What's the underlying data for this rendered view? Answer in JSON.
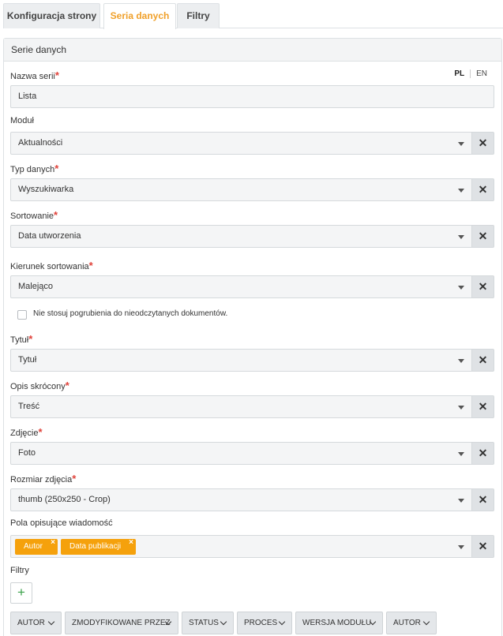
{
  "tabs": [
    {
      "label": "Konfiguracja strony"
    },
    {
      "label": "Seria danych"
    },
    {
      "label": "Filtry"
    }
  ],
  "active_tab": "Seria danych",
  "panel": {
    "title": "Serie danych"
  },
  "lang": {
    "pl": "PL",
    "en": "EN"
  },
  "form": {
    "required_mark": "*",
    "clear_glyph": "✕",
    "nazwa_serii": {
      "label": "Nazwa serii",
      "value": "Lista"
    },
    "modul": {
      "label": "Moduł",
      "value": "Aktualności"
    },
    "typ_danych": {
      "label": "Typ danych",
      "value": "Wyszukiwarka"
    },
    "sortowanie": {
      "label": "Sortowanie",
      "value": "Data utworzenia"
    },
    "kierunek": {
      "label": "Kierunek sortowania",
      "value": "Malejąco"
    },
    "checkbox": {
      "label": "Nie stosuj pogrubienia do nieodczytanych dokumentów.",
      "checked": false
    },
    "tytul": {
      "label": "Tytuł",
      "value": "Tytuł"
    },
    "opis": {
      "label": "Opis skrócony",
      "value": "Treść"
    },
    "zdjecie": {
      "label": "Zdjęcie",
      "value": "Foto"
    },
    "rozmiar": {
      "label": "Rozmiar zdjęcia",
      "value": "thumb (250x250 - Crop)"
    },
    "pola": {
      "label": "Pola opisujące wiadomość",
      "tags": [
        "Autor",
        "Data publikacji"
      ],
      "tag_remove": "×"
    },
    "filtry": {
      "label": "Filtry",
      "add": "+"
    }
  },
  "filter_buttons": [
    "AUTOR",
    "ZMODYFIKOWANE PRZEZ",
    "STATUS",
    "PROCES",
    "WERSJA MODUŁU",
    "AUTOR"
  ],
  "colors": {
    "accent": "#f0a02a",
    "tag": "#f5a10c",
    "required": "#e0423a",
    "add": "#3aa14a"
  }
}
